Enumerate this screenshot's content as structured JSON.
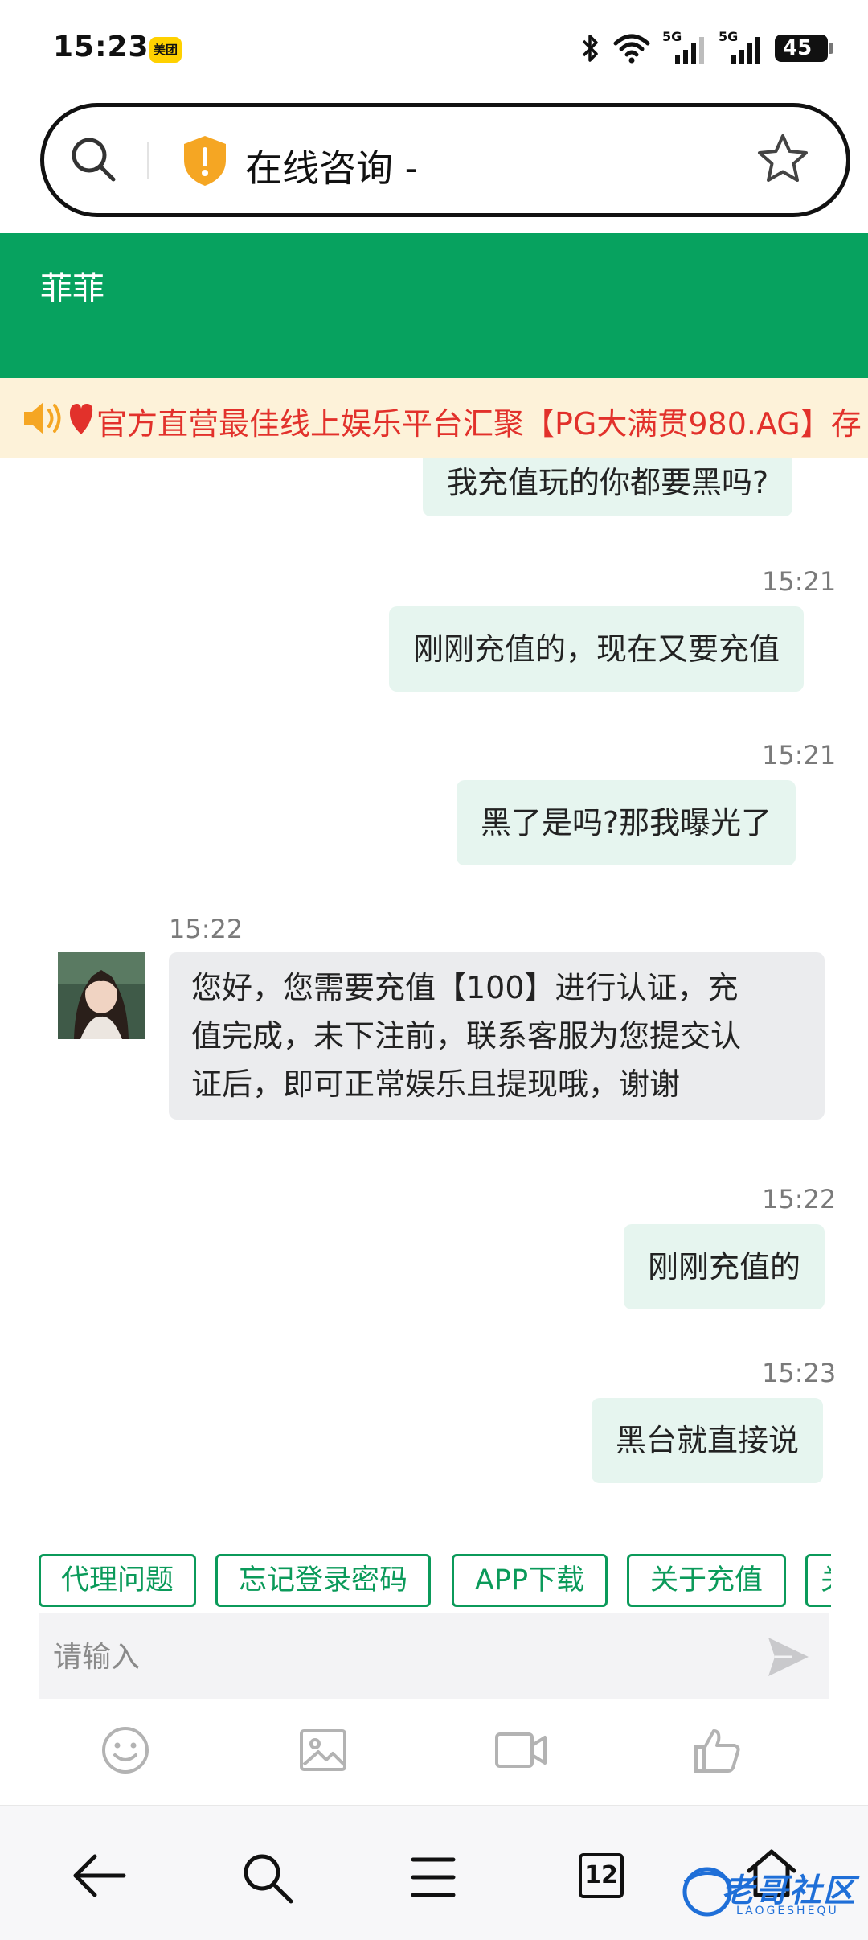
{
  "status_bar": {
    "time": "15:23",
    "app_badge": "美团",
    "signal_1": "5G",
    "signal_2": "5G",
    "battery": "45"
  },
  "address_bar": {
    "title": "在线咨询 -"
  },
  "chat": {
    "header_title": "菲菲",
    "marquee": "官方直营最佳线上娱乐平台汇聚【PG大满贯980.AG】存",
    "messages": [
      {
        "side": "out",
        "time": "",
        "text": "我充值玩的你都要黑吗?"
      },
      {
        "side": "out",
        "time": "15:21",
        "text": "刚刚充值的，现在又要充值"
      },
      {
        "side": "out",
        "time": "15:21",
        "text": "黑了是吗?那我曝光了"
      },
      {
        "side": "in",
        "time": "15:22",
        "lines": [
          "您好，您需要充值【100】进行认证，充",
          "值完成，未下注前，联系客服为您提交认",
          "证后，即可正常娱乐且提现哦，谢谢"
        ]
      },
      {
        "side": "out",
        "time": "15:22",
        "text": "刚刚充值的"
      },
      {
        "side": "out",
        "time": "15:23",
        "text": "黑台就直接说"
      }
    ],
    "quick_replies": [
      "代理问题",
      "忘记登录密码",
      "APP下载",
      "关于充值",
      "关"
    ],
    "input_placeholder": "请输入"
  },
  "browser_nav": {
    "tab_count": "12"
  },
  "watermark": {
    "text": "老哥社区",
    "sub": "LAOGESHEQU"
  },
  "colors": {
    "brand_green": "#07a25f",
    "outgoing_bubble": "#e6f5ef",
    "incoming_bubble": "#ebecee",
    "marquee_bg": "#fdf2d9",
    "marquee_text": "#e2312b"
  },
  "icons": [
    "search-icon",
    "shield-warning-icon",
    "star-icon",
    "speaker-icon",
    "heart-icon",
    "send-icon",
    "emoji-icon",
    "image-icon",
    "video-icon",
    "thumbs-up-icon",
    "back-arrow-icon",
    "menu-icon",
    "home-icon"
  ]
}
